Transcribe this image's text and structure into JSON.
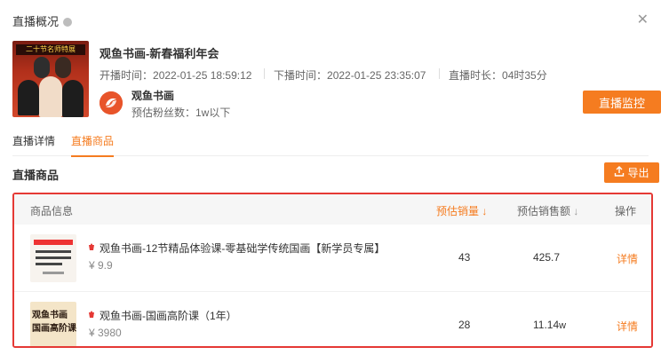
{
  "header": {
    "title": "直播概况",
    "close_glyph": "✕"
  },
  "live": {
    "cover_banner": "二十节名师特展",
    "title": "观鱼书画-新春福利年会",
    "start_label": "开播时间：",
    "start_time": "2022-01-25 18:59:12",
    "end_label": "下播时间：",
    "end_time": "2022-01-25 23:35:07",
    "duration_label": "直播时长：",
    "duration": "04时35分"
  },
  "account": {
    "name": "观鱼书画",
    "fans": "预估粉丝数：1w以下"
  },
  "buttons": {
    "monitor": "直播监控",
    "export": "导出"
  },
  "tabs": [
    {
      "label": "直播详情",
      "active": false
    },
    {
      "label": "直播商品",
      "active": true
    }
  ],
  "section_title": "直播商品",
  "table": {
    "columns": {
      "info": "商品信息",
      "sales": "预估销量",
      "amount": "预估销售额",
      "op": "操作"
    },
    "rows": [
      {
        "name": "观鱼书画-12节精品体验课-零基础学传统国画【新学员专属】",
        "price": "¥ 9.9",
        "sales": "43",
        "amount": "425.7",
        "amount_unit": "",
        "action": "详情"
      },
      {
        "name": "观鱼书画-国画高阶课（1年）",
        "price": "¥ 3980",
        "sales": "28",
        "amount": "11.14",
        "amount_unit": "w",
        "action": "详情",
        "thumb_text_1": "观鱼书画",
        "thumb_text_2": "国画高阶课"
      }
    ]
  },
  "colors": {
    "accent": "#f57c20",
    "highlight_border": "#e53935"
  },
  "icons": {
    "info": "info-icon",
    "close": "close-icon",
    "export": "export-icon",
    "sort": "sort-down-icon",
    "tag": "tiktok-shop-icon"
  }
}
